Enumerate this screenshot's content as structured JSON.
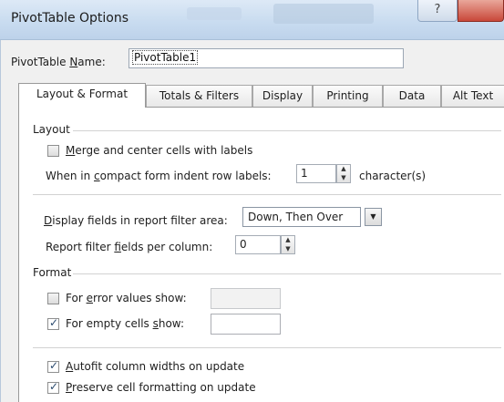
{
  "window": {
    "title": "PivotTable Options",
    "help_label": "?"
  },
  "name_row": {
    "label_pre": "PivotTable ",
    "label_accel": "N",
    "label_post": "ame:",
    "value": "PivotTable1"
  },
  "tabs": [
    {
      "label": "Layout & Format",
      "active": true
    },
    {
      "label": "Totals & Filters",
      "active": false
    },
    {
      "label": "Display",
      "active": false
    },
    {
      "label": "Printing",
      "active": false
    },
    {
      "label": "Data",
      "active": false
    },
    {
      "label": "Alt Text",
      "active": false
    }
  ],
  "layout_section": {
    "title": "Layout",
    "merge_pre": "",
    "merge_accel": "M",
    "merge_post": "erge and center cells with labels",
    "merge_checked": false,
    "indent_pre": "When in ",
    "indent_accel": "c",
    "indent_post": "ompact form indent row labels:",
    "indent_value": "1",
    "indent_unit": "character(s)",
    "display_pre": "",
    "display_accel": "D",
    "display_post": "isplay fields in report filter area:",
    "display_value": "Down, Then Over",
    "perc_pre": "Report filter ",
    "perc_accel": "f",
    "perc_post": "ields per column:",
    "perc_value": "0"
  },
  "format_section": {
    "title": "Format",
    "error_pre": "For ",
    "error_accel": "e",
    "error_post": "rror values show:",
    "error_checked": false,
    "empty_pre": "For empty cells ",
    "empty_accel": "s",
    "empty_post": "how:",
    "empty_checked": true,
    "autofit_pre": "",
    "autofit_accel": "A",
    "autofit_post": "utofit column widths on update",
    "autofit_checked": true,
    "preserve_pre": "",
    "preserve_accel": "P",
    "preserve_post": "reserve cell formatting on update",
    "preserve_checked": true
  },
  "icons": {
    "check": "checkmark-icon",
    "spin_up": "spin-up-icon",
    "spin_down": "spin-down-icon",
    "dropdown": "dropdown-arrow-icon"
  }
}
